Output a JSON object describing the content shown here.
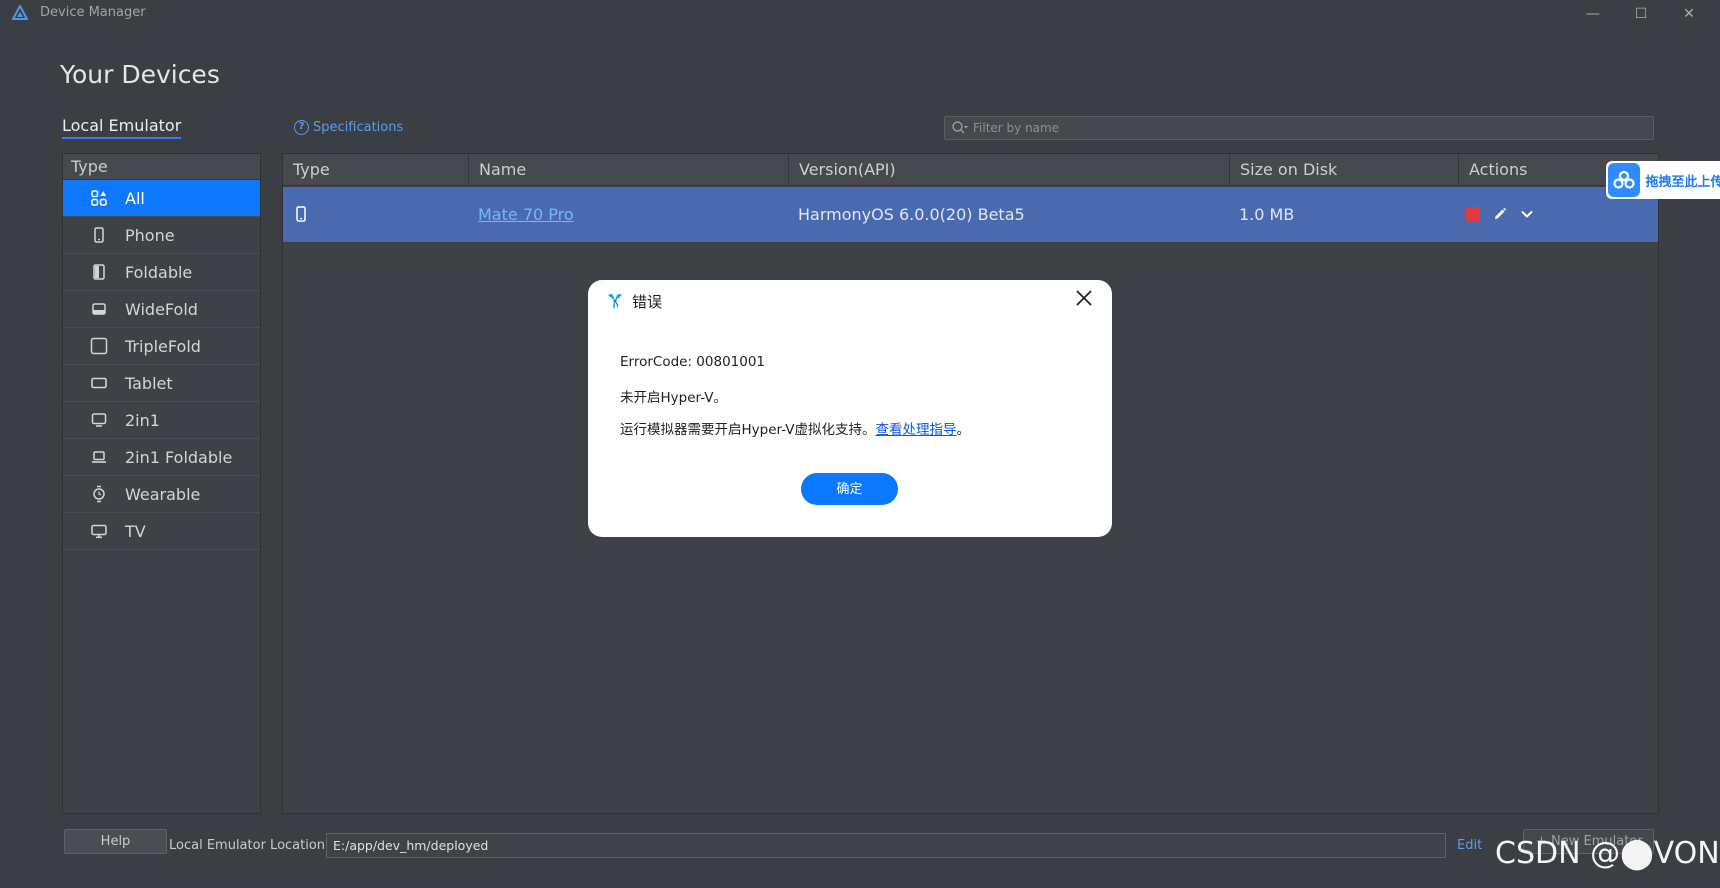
{
  "window": {
    "title": "Device Manager",
    "minimize": "—",
    "maximize": "☐",
    "close": "✕"
  },
  "page": {
    "title": "Your Devices",
    "local_tab": "Local Emulator",
    "specifications": "Specifications",
    "filter_placeholder": "Filter by name"
  },
  "types": {
    "header": "Type",
    "items": [
      {
        "label": "All",
        "icon": "grid-apps-icon",
        "active": true
      },
      {
        "label": "Phone",
        "icon": "phone-icon"
      },
      {
        "label": "Foldable",
        "icon": "foldable-icon"
      },
      {
        "label": "WideFold",
        "icon": "widefold-icon"
      },
      {
        "label": "TripleFold",
        "icon": "triplefold-icon"
      },
      {
        "label": "Tablet",
        "icon": "tablet-icon"
      },
      {
        "label": "2in1",
        "icon": "monitor-icon"
      },
      {
        "label": "2in1 Foldable",
        "icon": "laptop-icon"
      },
      {
        "label": "Wearable",
        "icon": "watch-icon"
      },
      {
        "label": "TV",
        "icon": "tv-icon"
      }
    ]
  },
  "table": {
    "columns": [
      "Type",
      "Name",
      "Version(API)",
      "Size on Disk",
      "Actions"
    ],
    "rows": [
      {
        "type_icon": "phone-icon",
        "name": "Mate 70 Pro",
        "version": "HarmonyOS 6.0.0(20) Beta5",
        "size": "1.0 MB",
        "actions": [
          "stop-icon",
          "edit-icon",
          "chevron-down-icon"
        ]
      }
    ]
  },
  "drag_widget": {
    "text": "拖拽至此上传"
  },
  "dialog": {
    "title": "错误",
    "error_code": "ErrorCode: 00801001",
    "line1": "未开启Hyper-V。",
    "line2_prefix": "运行模拟器需要开启Hyper-V虚拟化支持。",
    "line2_link": "查看处理指导",
    "line2_suffix": "。",
    "ok": "确定"
  },
  "bottom": {
    "help": "Help",
    "location_label": "Local Emulator Location:",
    "location_value": "E:/app/dev_hm/deployed",
    "edit": "Edit",
    "new_emulator": "+ New Emulator"
  },
  "watermark": "CSDN @⬤VON",
  "colors": {
    "background": "#3b3e42",
    "accent": "#0f78ff",
    "selected_row": "#4a6ab0",
    "link": "#5b9cf2",
    "stop": "#e5393d"
  }
}
